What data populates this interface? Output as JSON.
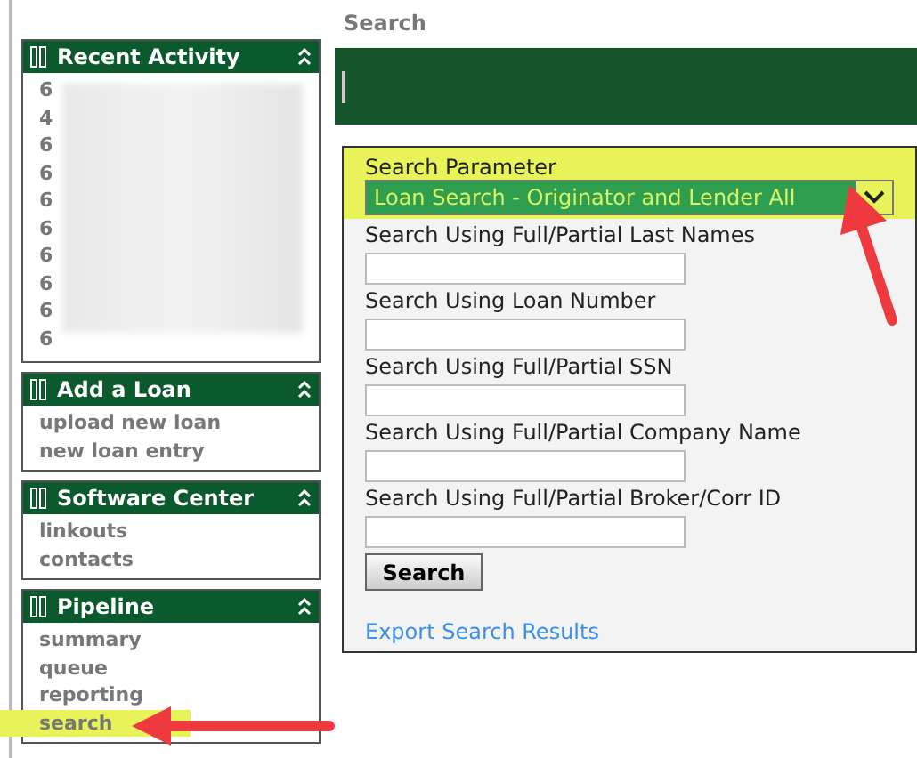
{
  "page_title": "Search",
  "sidebar": [
    {
      "title": "Recent Activity",
      "blurred": true,
      "items": [
        {
          "text": "6",
          "highlighted": false
        },
        {
          "text": "4",
          "highlighted": false
        },
        {
          "text": "6",
          "highlighted": false
        },
        {
          "text": "6",
          "highlighted": false
        },
        {
          "text": "6",
          "highlighted": false
        },
        {
          "text": "6",
          "highlighted": false
        },
        {
          "text": "6",
          "highlighted": false
        },
        {
          "text": "6",
          "highlighted": false
        },
        {
          "text": "6",
          "highlighted": false
        },
        {
          "text": "6",
          "highlighted": false
        }
      ]
    },
    {
      "title": "Add a Loan",
      "blurred": false,
      "items": [
        {
          "text": "upload new loan",
          "highlighted": false
        },
        {
          "text": "new loan entry",
          "highlighted": false
        }
      ]
    },
    {
      "title": "Software Center",
      "blurred": false,
      "items": [
        {
          "text": "linkouts",
          "highlighted": false
        },
        {
          "text": "contacts",
          "highlighted": false
        }
      ]
    },
    {
      "title": "Pipeline",
      "blurred": false,
      "items": [
        {
          "text": "summary",
          "highlighted": false
        },
        {
          "text": "queue",
          "highlighted": false
        },
        {
          "text": "reporting",
          "highlighted": false
        },
        {
          "text": "search",
          "highlighted": true
        }
      ]
    }
  ],
  "search_form": {
    "parameter_label": "Search Parameter",
    "parameter_value": "Loan Search - Originator and Lender All",
    "highlighted": true,
    "fields": [
      {
        "label": "Search Using Full/Partial Last Names"
      },
      {
        "label": "Search Using Loan Number"
      },
      {
        "label": "Search Using Full/Partial SSN"
      },
      {
        "label": "Search Using Full/Partial Company Name"
      },
      {
        "label": "Search Using Full/Partial Broker/Corr ID"
      }
    ],
    "button": "Search",
    "export_link": "Export Search Results"
  }
}
